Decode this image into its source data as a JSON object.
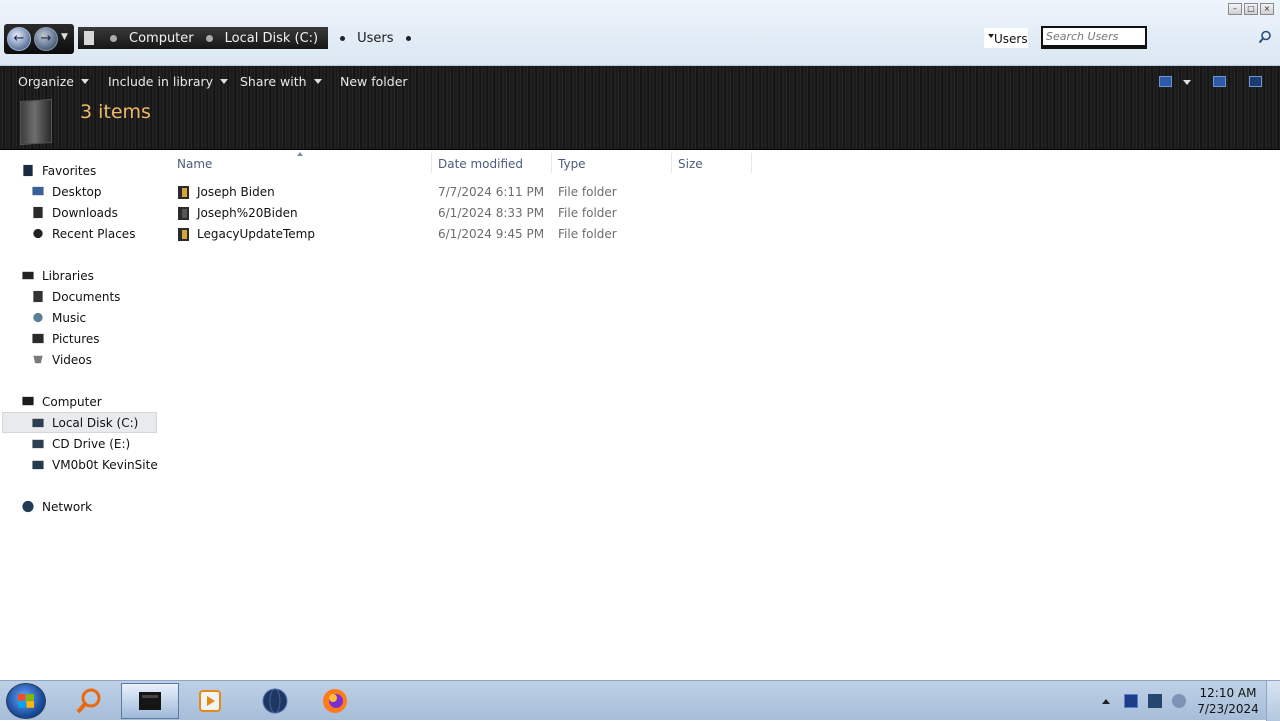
{
  "address": {
    "crumbs": [
      "Computer",
      "Local Disk (C:)",
      "Users"
    ],
    "mini_address": "Users",
    "search_placeholder": "Search Users"
  },
  "toolbar": {
    "organize": "Organize",
    "include_in_library": "Include in library",
    "share_with": "Share with",
    "new_folder": "New folder"
  },
  "details": {
    "items_count": "3 items"
  },
  "nav": {
    "favorites": "Favorites",
    "favorites_items": [
      "Desktop",
      "Downloads",
      "Recent Places"
    ],
    "libraries": "Libraries",
    "libraries_items": [
      "Documents",
      "Music",
      "Pictures",
      "Videos"
    ],
    "computer": "Computer",
    "computer_items": [
      "Local Disk (C:)",
      "CD Drive (E:)",
      "VM0b0t KevinSite"
    ],
    "network": "Network",
    "selected": "Local Disk (C:)"
  },
  "columns": {
    "name": "Name",
    "date_modified": "Date modified",
    "type": "Type",
    "size": "Size"
  },
  "files": [
    {
      "name": "Joseph Biden",
      "date": "7/7/2024 6:11 PM",
      "type": "File folder"
    },
    {
      "name": "Joseph%20Biden",
      "date": "6/1/2024 8:33 PM",
      "type": "File folder"
    },
    {
      "name": "LegacyUpdateTemp",
      "date": "6/1/2024 9:45 PM",
      "type": "File folder"
    }
  ],
  "taskbar": {
    "clock_time": "12:10 AM",
    "clock_date": "7/23/2024",
    "apps": [
      "search-app-icon",
      "explorer-icon",
      "media-player-icon",
      "globe-icon",
      "firefox-icon"
    ]
  },
  "colors": {
    "items_count": "#f0b867",
    "column_header": "#4b5d7a",
    "toolbar_bg": "#1b1b1b"
  }
}
